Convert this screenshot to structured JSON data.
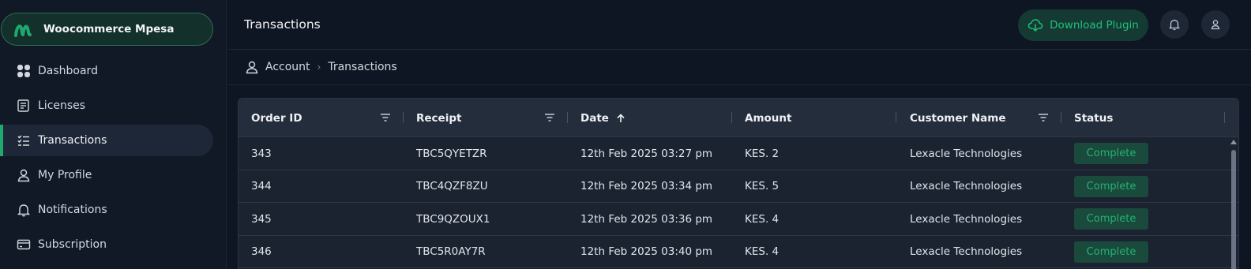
{
  "sidebar": {
    "brand": "Woocommerce Mpesa",
    "items": [
      {
        "label": "Dashboard",
        "icon": "dashboard-icon"
      },
      {
        "label": "Licenses",
        "icon": "license-icon"
      },
      {
        "label": "Transactions",
        "icon": "transactions-icon",
        "active": true
      },
      {
        "label": "My Profile",
        "icon": "user-icon"
      },
      {
        "label": "Notifications",
        "icon": "bell-icon"
      },
      {
        "label": "Subscription",
        "icon": "card-icon"
      }
    ]
  },
  "header": {
    "title": "Transactions",
    "download_label": "Download Plugin"
  },
  "breadcrumb": {
    "items": [
      "Account",
      "Transactions"
    ]
  },
  "table": {
    "columns": [
      "Order ID",
      "Receipt",
      "Date",
      "Amount",
      "Customer Name",
      "Status"
    ],
    "rows": [
      {
        "order_id": "343",
        "receipt": "TBC5QYETZR",
        "date": "12th Feb 2025 03:27 pm",
        "amount": "KES. 2",
        "customer": "Lexacle Technologies",
        "status": "Complete"
      },
      {
        "order_id": "344",
        "receipt": "TBC4QZF8ZU",
        "date": "12th Feb 2025 03:34 pm",
        "amount": "KES. 5",
        "customer": "Lexacle Technologies",
        "status": "Complete"
      },
      {
        "order_id": "345",
        "receipt": "TBC9QZOUX1",
        "date": "12th Feb 2025 03:36 pm",
        "amount": "KES. 4",
        "customer": "Lexacle Technologies",
        "status": "Complete"
      },
      {
        "order_id": "346",
        "receipt": "TBC5R0AY7R",
        "date": "12th Feb 2025 03:40 pm",
        "amount": "KES. 4",
        "customer": "Lexacle Technologies",
        "status": "Complete"
      }
    ]
  },
  "colors": {
    "accent": "#1fa86f",
    "background": "#0f1623",
    "status_complete": "#22b274"
  }
}
